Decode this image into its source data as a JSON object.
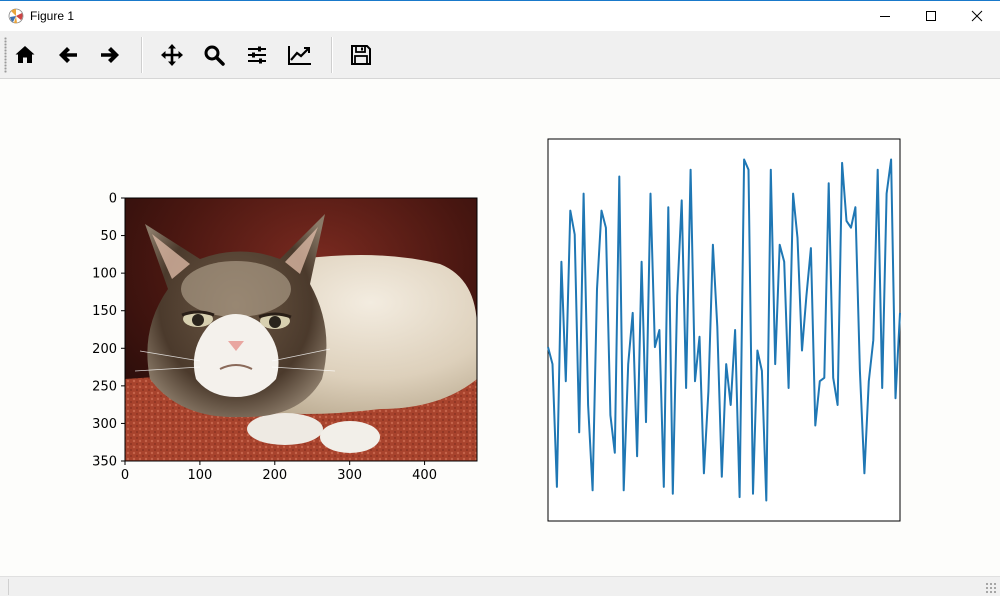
{
  "window": {
    "title": "Figure 1",
    "controls": [
      "minimize",
      "maximize",
      "close"
    ]
  },
  "toolbar": {
    "tools": [
      {
        "name": "home",
        "icon": "home-icon"
      },
      {
        "name": "back",
        "icon": "arrow-left-icon"
      },
      {
        "name": "forward",
        "icon": "arrow-right-icon"
      },
      {
        "name": "pan",
        "icon": "move-icon"
      },
      {
        "name": "zoom",
        "icon": "magnifier-icon"
      },
      {
        "name": "subplots",
        "icon": "sliders-icon"
      },
      {
        "name": "customize",
        "icon": "line-chart-icon"
      },
      {
        "name": "save",
        "icon": "floppy-disk-icon"
      }
    ]
  },
  "image_axes": {
    "content": "photo of a grumpy cat lying on a red rug",
    "x_ticks": [
      "0",
      "100",
      "200",
      "300",
      "400"
    ],
    "y_ticks": [
      "0",
      "50",
      "100",
      "150",
      "200",
      "250",
      "300",
      "350"
    ],
    "xlim": [
      0,
      470
    ],
    "ylim": [
      350,
      0
    ]
  },
  "chart_data": {
    "type": "line",
    "axis_visible": false,
    "color": "#1f77b4",
    "xlim": [
      0,
      79
    ],
    "ylim": [
      -0.06,
      1.06
    ],
    "x": [
      0,
      1,
      2,
      3,
      4,
      5,
      6,
      7,
      8,
      9,
      10,
      11,
      12,
      13,
      14,
      15,
      16,
      17,
      18,
      19,
      20,
      21,
      22,
      23,
      24,
      25,
      26,
      27,
      28,
      29,
      30,
      31,
      32,
      33,
      34,
      35,
      36,
      37,
      38,
      39,
      40,
      41,
      42,
      43,
      44,
      45,
      46,
      47,
      48,
      49,
      50,
      51,
      52,
      53,
      54,
      55,
      56,
      57,
      58,
      59,
      60,
      61,
      62,
      63,
      64,
      65,
      66,
      67,
      68,
      69,
      70,
      71,
      72,
      73,
      74,
      75,
      76,
      77,
      78,
      79
    ],
    "values": [
      0.45,
      0.4,
      0.04,
      0.7,
      0.35,
      0.85,
      0.78,
      0.2,
      0.9,
      0.28,
      0.03,
      0.62,
      0.85,
      0.8,
      0.25,
      0.14,
      0.95,
      0.03,
      0.4,
      0.55,
      0.13,
      0.7,
      0.23,
      0.9,
      0.45,
      0.5,
      0.04,
      0.86,
      0.02,
      0.6,
      0.88,
      0.33,
      0.97,
      0.35,
      0.48,
      0.08,
      0.32,
      0.75,
      0.51,
      0.07,
      0.4,
      0.28,
      0.5,
      0.01,
      1.0,
      0.97,
      0.02,
      0.44,
      0.38,
      0.0,
      0.97,
      0.4,
      0.75,
      0.7,
      0.33,
      0.9,
      0.77,
      0.44,
      0.6,
      0.74,
      0.22,
      0.35,
      0.36,
      0.93,
      0.36,
      0.28,
      0.99,
      0.82,
      0.8,
      0.86,
      0.38,
      0.08,
      0.35,
      0.47,
      0.97,
      0.33,
      0.9,
      1.0,
      0.3,
      0.55
    ]
  }
}
